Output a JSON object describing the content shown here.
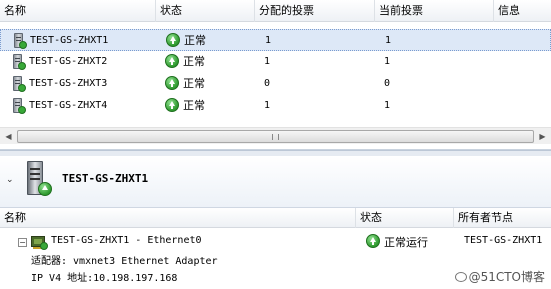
{
  "top_table": {
    "headers": [
      "名称",
      "状态",
      "分配的投票",
      "当前投票",
      "信息"
    ],
    "rows": [
      {
        "name": "TEST-GS-ZHXT1",
        "status": "正常",
        "assigned": "1",
        "current": "1"
      },
      {
        "name": "TEST-GS-ZHXT2",
        "status": "正常",
        "assigned": "1",
        "current": "1"
      },
      {
        "name": "TEST-GS-ZHXT3",
        "status": "正常",
        "assigned": "0",
        "current": "0"
      },
      {
        "name": "TEST-GS-ZHXT4",
        "status": "正常",
        "assigned": "1",
        "current": "1"
      }
    ],
    "selected_row": 0,
    "scroll_left_arrow": "◀",
    "scroll_right_arrow": "▶"
  },
  "details": {
    "collapse_glyph": "⌄",
    "node_name": "TEST-GS-ZHXT1",
    "headers": [
      "名称",
      "状态",
      "所有者节点"
    ],
    "tree_toggle": "−",
    "item_name": "TEST-GS-ZHXT1 - Ethernet0",
    "item_status": "正常运行",
    "item_owner": "TEST-GS-ZHXT1",
    "adapter_line": "适配器: vmxnet3 Ethernet Adapter",
    "ip_line": "IP V4 地址:10.198.197.168"
  },
  "watermark": "@51CTO博客"
}
